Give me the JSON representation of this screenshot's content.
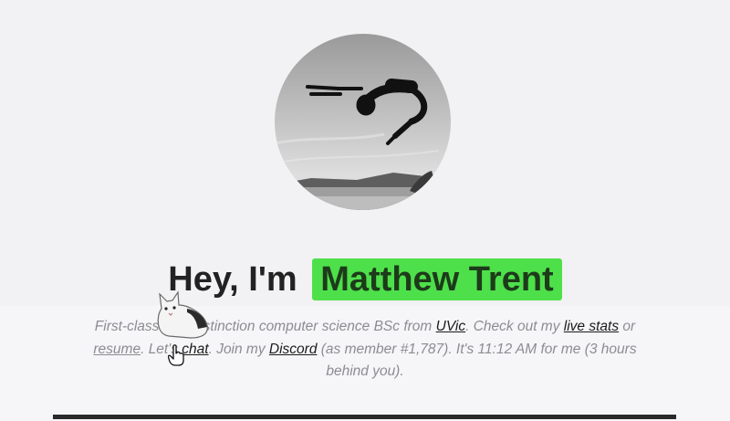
{
  "hero": {
    "greeting": "Hey, I'm",
    "name": "Matthew Trent"
  },
  "bio": {
    "part1": "First-class",
    "part2": " with distinction computer science BSc from ",
    "uvic_link": "UVic",
    "part3": ". Check out my ",
    "live_stats_link": "live stats",
    "part4": " or ",
    "resume_link": "resume",
    "part5": ". Let's ",
    "chat_link": "chat",
    "part6": ". Join my ",
    "discord_link": "Discord",
    "part7": " (as member #1,787). It's 11:12 AM for me (3 hours behind you)."
  },
  "icons": {
    "avatar": "profile-photo-backflip",
    "cat": "cat-sticker",
    "cursor": "hand-pointer-cursor"
  },
  "colors": {
    "background": "#f2f1f3",
    "name_highlight": "#4ee04a",
    "bio_text": "#8d8c92",
    "divider": "#2a2a2a"
  }
}
